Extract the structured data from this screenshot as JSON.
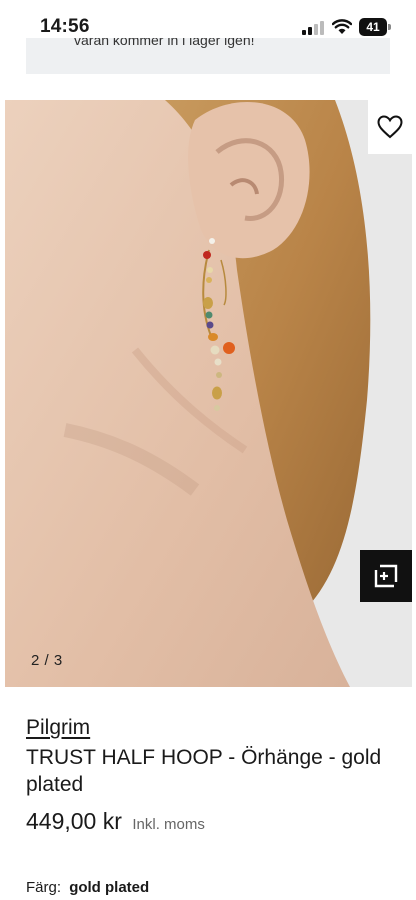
{
  "status_bar": {
    "time": "14:56",
    "battery": "41"
  },
  "notice": {
    "text": "varan kommer in i lager igen!"
  },
  "gallery": {
    "counter": "2 / 3"
  },
  "product": {
    "brand": "Pilgrim",
    "title": "TRUST HALF HOOP - Örhänge - gold plated",
    "price": "449,00 kr",
    "vat_note": "Inkl. moms",
    "color_label": "Färg:",
    "color_value": "gold plated"
  },
  "icons": {
    "wishlist": "heart-outline-icon",
    "view": "view-in-space-icon",
    "signal": "cellular-signal-icon",
    "wifi": "wifi-icon",
    "battery": "battery-icon"
  },
  "colors": {
    "accent_dark": "#111111",
    "banner_bg": "#eef0f2"
  }
}
